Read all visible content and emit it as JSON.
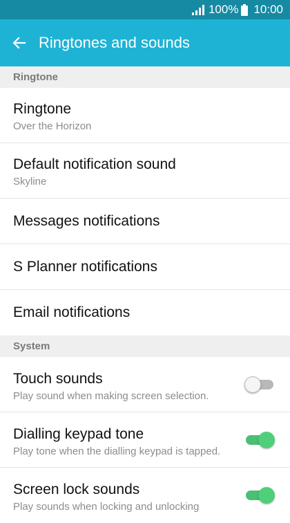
{
  "status_bar": {
    "battery_percent": "100%",
    "time": "10:00",
    "signal_icon": "signal-icon",
    "battery_icon": "battery-icon"
  },
  "app_bar": {
    "back_icon": "back-arrow-icon",
    "title": "Ringtones and sounds"
  },
  "sections": {
    "ringtone": {
      "header": "Ringtone",
      "items": [
        {
          "title": "Ringtone",
          "subtitle": "Over the Horizon"
        },
        {
          "title": "Default notification sound",
          "subtitle": "Skyline"
        },
        {
          "title": "Messages notifications"
        },
        {
          "title": "S Planner notifications"
        },
        {
          "title": "Email notifications"
        }
      ]
    },
    "system": {
      "header": "System",
      "items": [
        {
          "title": "Touch sounds",
          "subtitle": "Play sound when making screen selection.",
          "enabled": false
        },
        {
          "title": "Dialling keypad tone",
          "subtitle": "Play tone when the dialling keypad is tapped.",
          "enabled": true
        },
        {
          "title": "Screen lock sounds",
          "subtitle": "Play sounds when locking and unlocking",
          "enabled": true
        }
      ]
    }
  },
  "colors": {
    "status_bar": "#168aa3",
    "app_bar": "#1eb3d4",
    "toggle_on": "#4bbf73",
    "toggle_off": "#b8b8b8"
  }
}
